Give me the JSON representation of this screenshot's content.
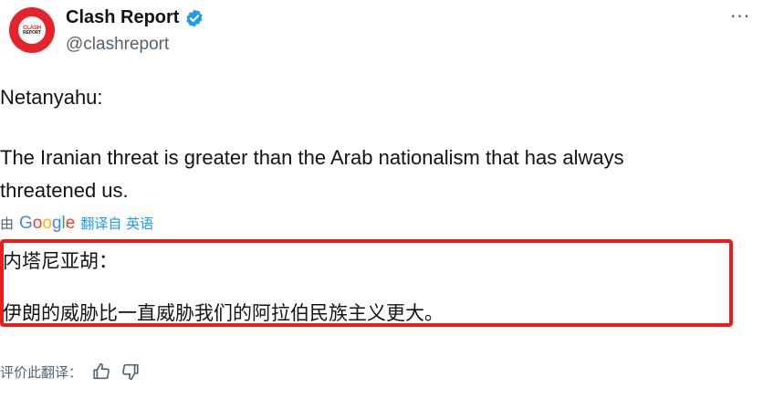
{
  "author": {
    "name": "Clash Report",
    "handle": "@clashreport",
    "avatar_text_top": "CLASH",
    "avatar_text_bottom": "REPORT"
  },
  "menu": {
    "more_label": "···"
  },
  "tweet": {
    "line1": "Netanyahu:",
    "line2": "The Iranian threat is greater than the Arab nationalism that has always",
    "line3": "threatened us."
  },
  "translation_bar": {
    "prefix": "由",
    "provider_letters": [
      "G",
      "o",
      "o",
      "g",
      "l",
      "e"
    ],
    "from_text": "翻译自 英语"
  },
  "translation": {
    "line1": "内塔尼亚胡：",
    "line2": "伊朗的威胁比一直威胁我们的阿拉伯民族主义更大。"
  },
  "rating": {
    "label": "评价此翻译："
  },
  "colors": {
    "verified": "#1d9bf0",
    "highlight_box": "#ea1c1c",
    "brand": "#e4232b"
  }
}
